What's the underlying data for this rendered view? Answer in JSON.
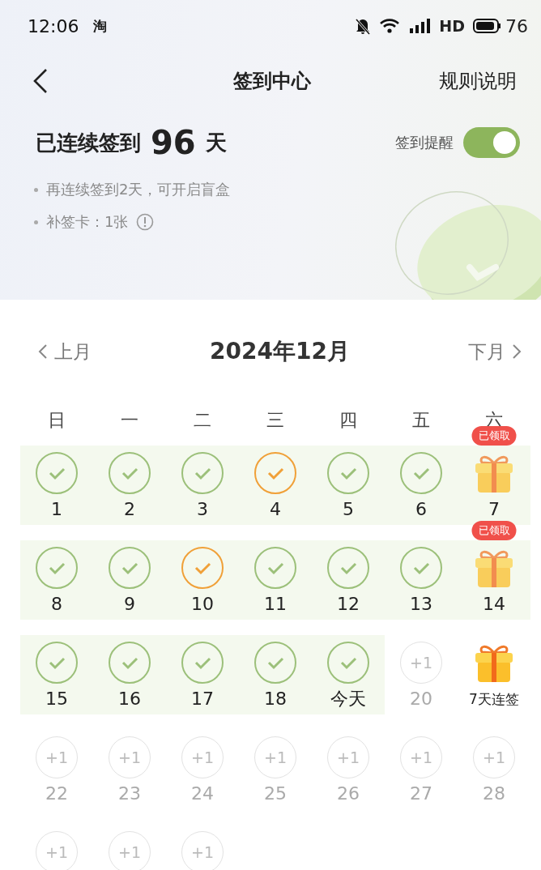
{
  "status_bar": {
    "time": "12:06",
    "app_glyph": "淘",
    "network": "HD",
    "battery": "76"
  },
  "header": {
    "title": "签到中心",
    "action": "规则说明"
  },
  "streak": {
    "prefix": "已连续签到",
    "count": "96",
    "unit": "天",
    "reminder_label": "签到提醒",
    "reminder_on": true
  },
  "notes": [
    {
      "text": "再连续签到2天，可开启盲盒",
      "info": false
    },
    {
      "text": "补签卡：1张",
      "info": true
    }
  ],
  "month_nav": {
    "prev": "上月",
    "title": "2024年12月",
    "next": "下月"
  },
  "weekdays": [
    "日",
    "一",
    "二",
    "三",
    "四",
    "五",
    "六"
  ],
  "weeks": [
    [
      {
        "kind": "check",
        "color": "#9cc07a",
        "label": "1",
        "in_streak": true
      },
      {
        "kind": "check",
        "color": "#9cc07a",
        "label": "2",
        "in_streak": true
      },
      {
        "kind": "check",
        "color": "#9cc07a",
        "label": "3",
        "in_streak": true
      },
      {
        "kind": "check",
        "color": "#f0a038",
        "label": "4",
        "in_streak": true
      },
      {
        "kind": "check",
        "color": "#9cc07a",
        "label": "5",
        "in_streak": true
      },
      {
        "kind": "check",
        "color": "#9cc07a",
        "label": "6",
        "in_streak": true
      },
      {
        "kind": "gift",
        "badge": "已领取",
        "label": "7",
        "in_streak": true
      }
    ],
    [
      {
        "kind": "check",
        "color": "#9cc07a",
        "label": "8",
        "in_streak": true
      },
      {
        "kind": "check",
        "color": "#9cc07a",
        "label": "9",
        "in_streak": true
      },
      {
        "kind": "check",
        "color": "#f0a038",
        "label": "10",
        "in_streak": true
      },
      {
        "kind": "check",
        "color": "#9cc07a",
        "label": "11",
        "in_streak": true
      },
      {
        "kind": "check",
        "color": "#9cc07a",
        "label": "12",
        "in_streak": true
      },
      {
        "kind": "check",
        "color": "#9cc07a",
        "label": "13",
        "in_streak": true
      },
      {
        "kind": "gift",
        "badge": "已领取",
        "label": "14",
        "in_streak": true
      }
    ],
    [
      {
        "kind": "check",
        "color": "#9cc07a",
        "label": "15",
        "in_streak": true
      },
      {
        "kind": "check",
        "color": "#9cc07a",
        "label": "16",
        "in_streak": true
      },
      {
        "kind": "check",
        "color": "#9cc07a",
        "label": "17",
        "in_streak": true
      },
      {
        "kind": "check",
        "color": "#9cc07a",
        "label": "18",
        "in_streak": true
      },
      {
        "kind": "check",
        "color": "#9cc07a",
        "label": "今天",
        "in_streak": true
      },
      {
        "kind": "plus",
        "mark": "+1",
        "label": "20",
        "in_streak": false
      },
      {
        "kind": "gift",
        "label": "7天连签",
        "in_streak": false
      }
    ],
    [
      {
        "kind": "plus",
        "mark": "+1",
        "label": "22",
        "in_streak": false
      },
      {
        "kind": "plus",
        "mark": "+1",
        "label": "23",
        "in_streak": false
      },
      {
        "kind": "plus",
        "mark": "+1",
        "label": "24",
        "in_streak": false
      },
      {
        "kind": "plus",
        "mark": "+1",
        "label": "25",
        "in_streak": false
      },
      {
        "kind": "plus",
        "mark": "+1",
        "label": "26",
        "in_streak": false
      },
      {
        "kind": "plus",
        "mark": "+1",
        "label": "27",
        "in_streak": false
      },
      {
        "kind": "plus",
        "mark": "+1",
        "label": "28",
        "in_streak": false
      }
    ],
    [
      {
        "kind": "plus",
        "mark": "+1",
        "in_streak": false
      },
      {
        "kind": "plus",
        "mark": "+1",
        "in_streak": false
      },
      {
        "kind": "plus",
        "mark": "+1",
        "in_streak": false
      }
    ]
  ]
}
